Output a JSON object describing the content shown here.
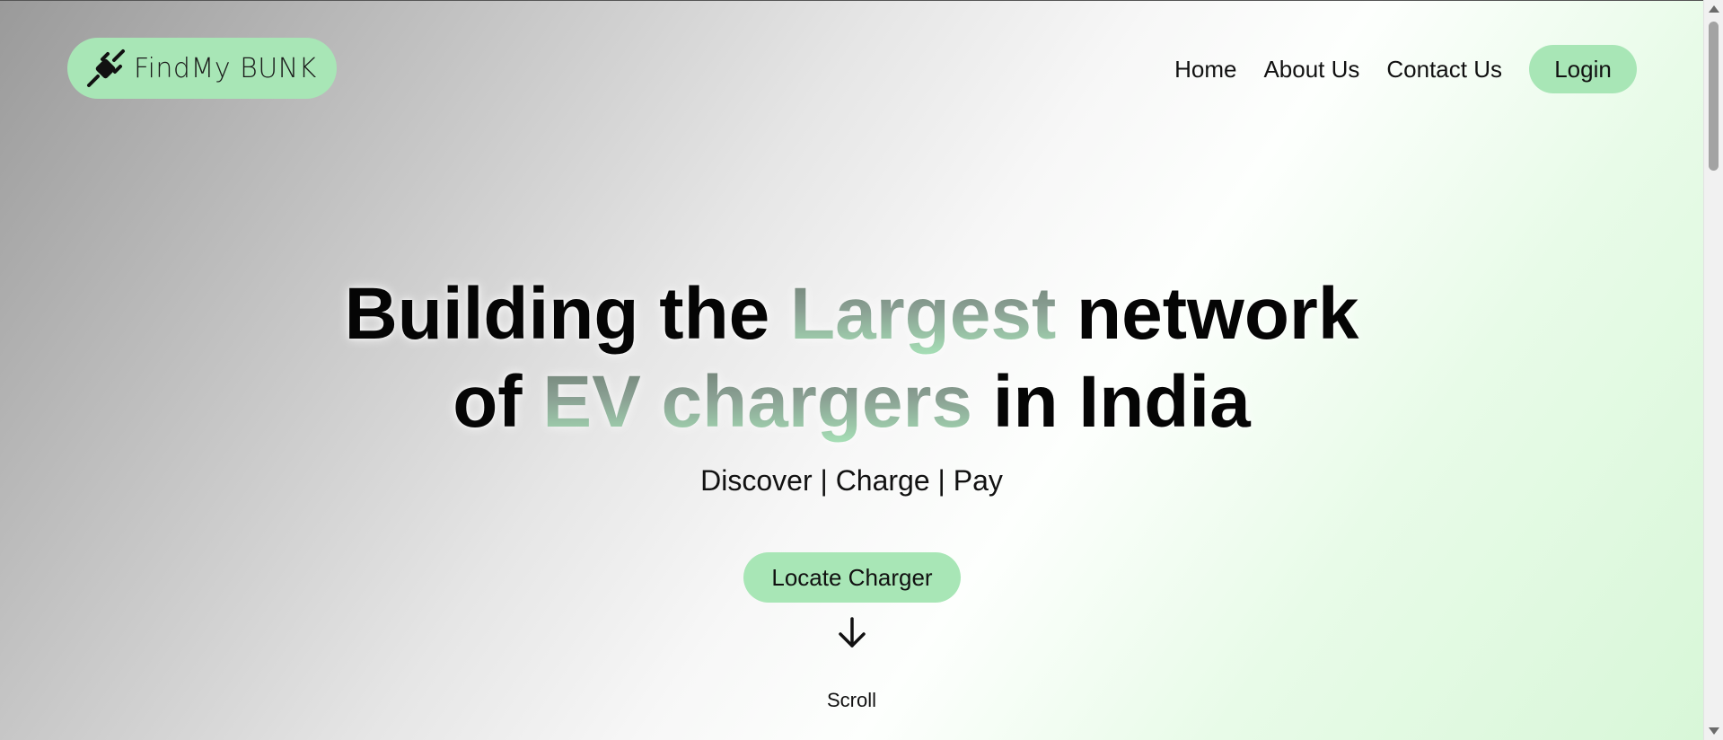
{
  "brand": {
    "name": "FindMy BUNK",
    "accent_color": "#a8e6b6",
    "icon": "plug-icon"
  },
  "nav": {
    "items": [
      {
        "label": "Home"
      },
      {
        "label": "About Us"
      },
      {
        "label": "Contact Us"
      }
    ],
    "login_label": "Login"
  },
  "hero": {
    "headline": {
      "part1": "Building the ",
      "highlight1": "Largest",
      "part2": " network",
      "part3": "of ",
      "highlight2": "EV chargers",
      "part4": " in India"
    },
    "tagline": "Discover | Charge | Pay",
    "cta_label": "Locate Charger",
    "scroll_icon": "arrow-down-icon",
    "scroll_label": "Scroll"
  }
}
